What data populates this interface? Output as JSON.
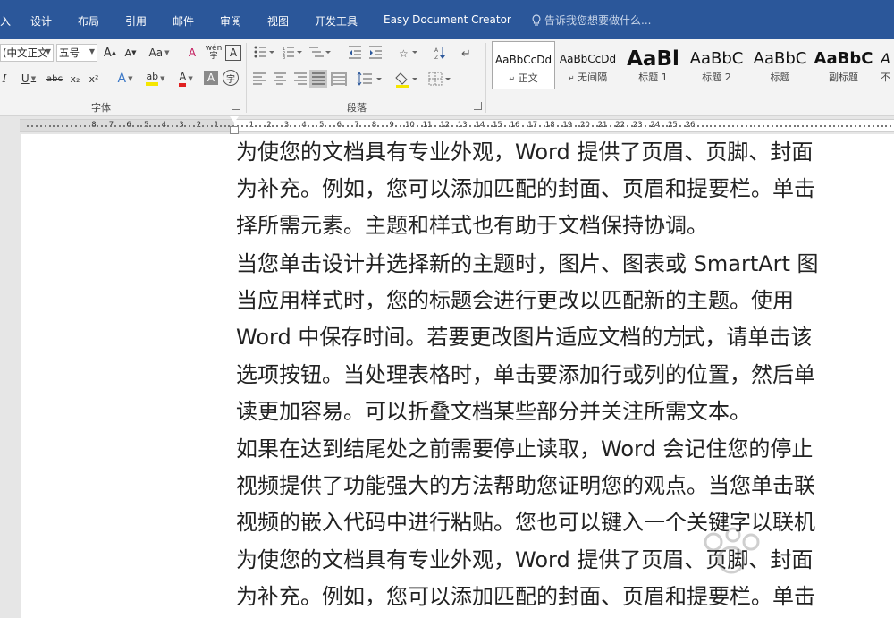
{
  "tabs": [
    {
      "label": "入"
    },
    {
      "label": "设计"
    },
    {
      "label": "布局"
    },
    {
      "label": "引用"
    },
    {
      "label": "邮件"
    },
    {
      "label": "审阅"
    },
    {
      "label": "视图"
    },
    {
      "label": "开发工具"
    },
    {
      "label": "Easy Document Creator"
    }
  ],
  "tell_me": {
    "text": "告诉我您想要做什么..."
  },
  "font": {
    "name": "(中文正文",
    "size": "五号",
    "grow": "A",
    "shrink": "A",
    "change_case": "Aa",
    "clear_format": "A",
    "phonetic": "wén",
    "char_border": "A",
    "bold": "I",
    "underline": "U",
    "strike": "abc",
    "subscript": "x₂",
    "superscript": "x²",
    "text_effect": "A",
    "highlight": "ab",
    "font_color": "A",
    "char_shading": "A",
    "enclose": "字",
    "group_label": "字体",
    "font_color_hex": "#e02020",
    "highlight_hex": "#f5e600"
  },
  "paragraph": {
    "group_label": "段落"
  },
  "styles": [
    {
      "preview": "AaBbCcDd",
      "name": "正文",
      "selected": true
    },
    {
      "preview": "AaBbCcDd",
      "name": "无间隔",
      "selected": false
    },
    {
      "preview": "AaBl",
      "name": "标题 1",
      "selected": false
    },
    {
      "preview": "AaBbC",
      "name": "标题 2",
      "selected": false
    },
    {
      "preview": "AaBbC",
      "name": "标题",
      "selected": false
    },
    {
      "preview": "AaBbC",
      "name": "副标题",
      "selected": false
    },
    {
      "preview": "A",
      "name": "不",
      "selected": false
    }
  ],
  "ruler": {
    "left_numbers": [
      "8",
      "7",
      "6",
      "5",
      "4",
      "3",
      "2",
      "1"
    ],
    "right_numbers": [
      "1",
      "2",
      "3",
      "4",
      "5",
      "6",
      "7",
      "8",
      "9",
      "10",
      "11",
      "12",
      "13",
      "14",
      "15",
      "16",
      "17",
      "18",
      "19",
      "20",
      "21",
      "22",
      "23",
      "24",
      "25",
      "26"
    ]
  },
  "document": {
    "lines": [
      "为使您的文档具有专业外观，Word 提供了页眉、页脚、封面",
      "为补充。例如，您可以添加匹配的封面、页眉和提要栏。单击",
      "择所需元素。主题和样式也有助于文档保持协调。",
      "当您单击设计并选择新的主题时，图片、图表或 SmartArt 图",
      "当应用样式时，您的标题会进行更改以匹配新的主题。使用",
      "Word 中保存时间。若要更改图片适应文档的方式，请单击该",
      "选项按钮。当处理表格时，单击要添加行或列的位置，然后单",
      "读更加容易。可以折叠文档某些部分并关注所需文本。",
      "如果在达到结尾处之前需要停止读取，Word 会记住您的停止",
      "视频提供了功能强大的方法帮助您证明您的观点。当您单击联",
      "视频的嵌入代码中进行粘贴。您也可以键入一个关键字以联机",
      "为使您的文档具有专业外观，Word 提供了页眉、页脚、封面",
      "为补充。例如，您可以添加匹配的封面、页眉和提要栏。单击"
    ],
    "cursor_line": 5,
    "cursor_before": "Word 中保存时间。若要更改图片适应文档的方",
    "cursor_after": "式，请单击该"
  },
  "colors": {
    "ribbon_blue": "#2b579a",
    "ribbon_bg": "#f3f3f3",
    "doc_bg": "#e6e6e6"
  }
}
